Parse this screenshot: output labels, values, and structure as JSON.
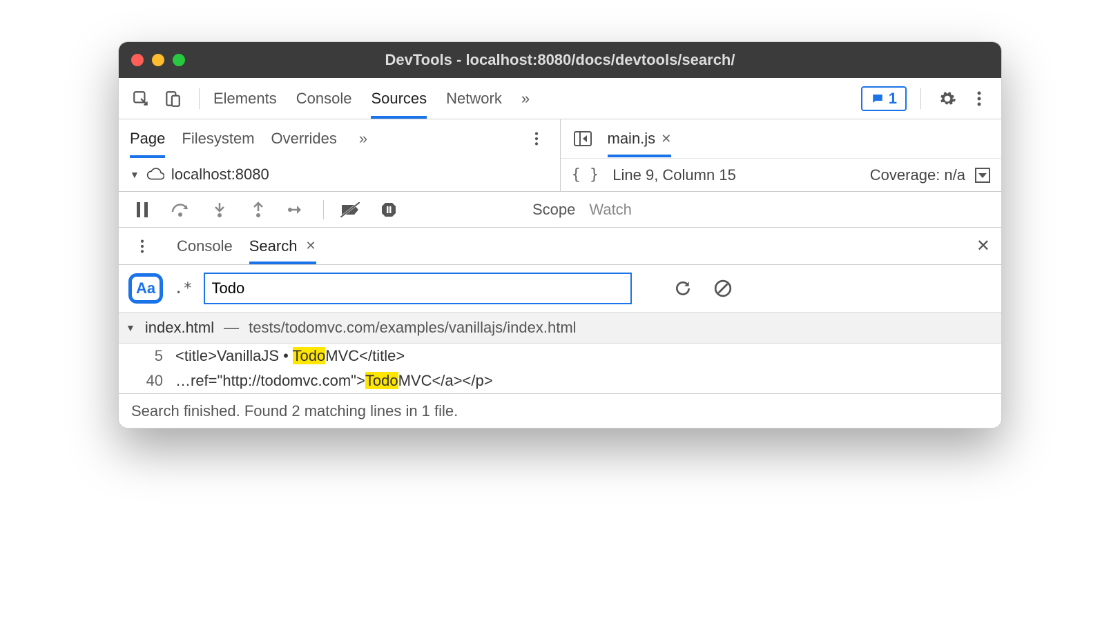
{
  "window": {
    "title": "DevTools - localhost:8080/docs/devtools/search/"
  },
  "mainTabs": {
    "items": [
      "Elements",
      "Console",
      "Sources",
      "Network"
    ],
    "overflow": "»",
    "feedbackCount": "1"
  },
  "navigator": {
    "tabs": [
      "Page",
      "Filesystem",
      "Overrides"
    ],
    "overflow": "»",
    "host": "localhost:8080"
  },
  "editor": {
    "fileName": "main.js",
    "cursor": "Line 9, Column 15",
    "coverage": "Coverage: n/a"
  },
  "debuggerTabs": {
    "scope": "Scope",
    "watch": "Watch"
  },
  "drawer": {
    "tabs": {
      "console": "Console",
      "search": "Search"
    }
  },
  "search": {
    "caseLabel": "Aa",
    "regexLabel": ".*",
    "query": "Todo"
  },
  "results": {
    "file": {
      "name": "index.html",
      "path": "tests/todomvc.com/examples/vanillajs/index.html"
    },
    "lines": [
      {
        "n": "5",
        "pre": "<title>VanillaJS • ",
        "match": "Todo",
        "post": "MVC</title>"
      },
      {
        "n": "40",
        "pre": "…ref=\"http://todomvc.com\">",
        "match": "Todo",
        "post": "MVC</a></p>"
      }
    ]
  },
  "status": "Search finished.  Found 2 matching lines in 1 file."
}
